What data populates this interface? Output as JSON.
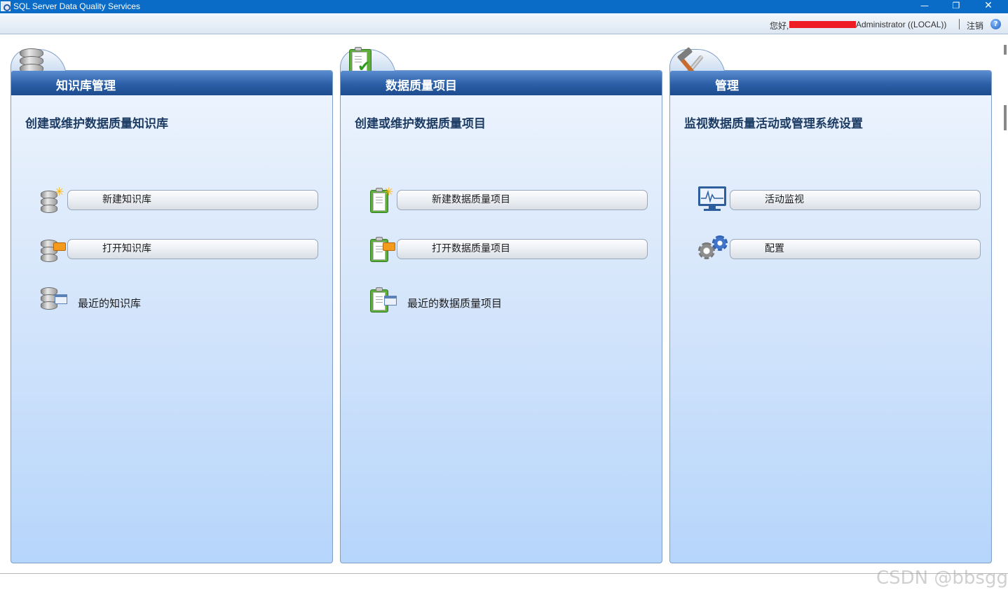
{
  "window": {
    "title": "SQL Server Data Quality Services",
    "minimize_glyph": "—",
    "maximize_glyph": "❐",
    "close_glyph": "✕"
  },
  "userbar": {
    "greeting": "您好,",
    "user": "Administrator ((LOCAL))",
    "logout_label": "注销",
    "help_glyph": "?"
  },
  "panels": [
    {
      "title": "知识库管理",
      "subtitle": "创建或维护数据质量知识库",
      "icon": "database-icon",
      "actions": [
        {
          "label": "新建知识库",
          "icon": "new-knowledge-base-icon"
        },
        {
          "label": "打开知识库",
          "icon": "open-knowledge-base-icon"
        }
      ],
      "recent": {
        "label": "最近的知识库",
        "icon": "recent-knowledge-base-icon"
      }
    },
    {
      "title": "数据质量项目",
      "subtitle": "创建或维护数据质量项目",
      "icon": "clipboard-check-icon",
      "actions": [
        {
          "label": "新建数据质量项目",
          "icon": "new-project-icon"
        },
        {
          "label": "打开数据质量项目",
          "icon": "open-project-icon"
        }
      ],
      "recent": {
        "label": "最近的数据质量项目",
        "icon": "recent-project-icon"
      }
    },
    {
      "title": "管理",
      "subtitle": "监视数据质量活动或管理系统设置",
      "icon": "tools-icon",
      "actions": [
        {
          "label": "活动监视",
          "icon": "monitor-icon"
        },
        {
          "label": "配置",
          "icon": "gears-icon"
        }
      ]
    }
  ],
  "watermark": "CSDN @bbsggy",
  "colors": {
    "titlebar": "#0a6cc7",
    "panel_header": "#2b5fa6",
    "panel_body_top": "#eef5fe",
    "panel_body_bottom": "#b6d5fb",
    "subtitle_text": "#1d3c64",
    "redaction": "#ee1c24"
  }
}
